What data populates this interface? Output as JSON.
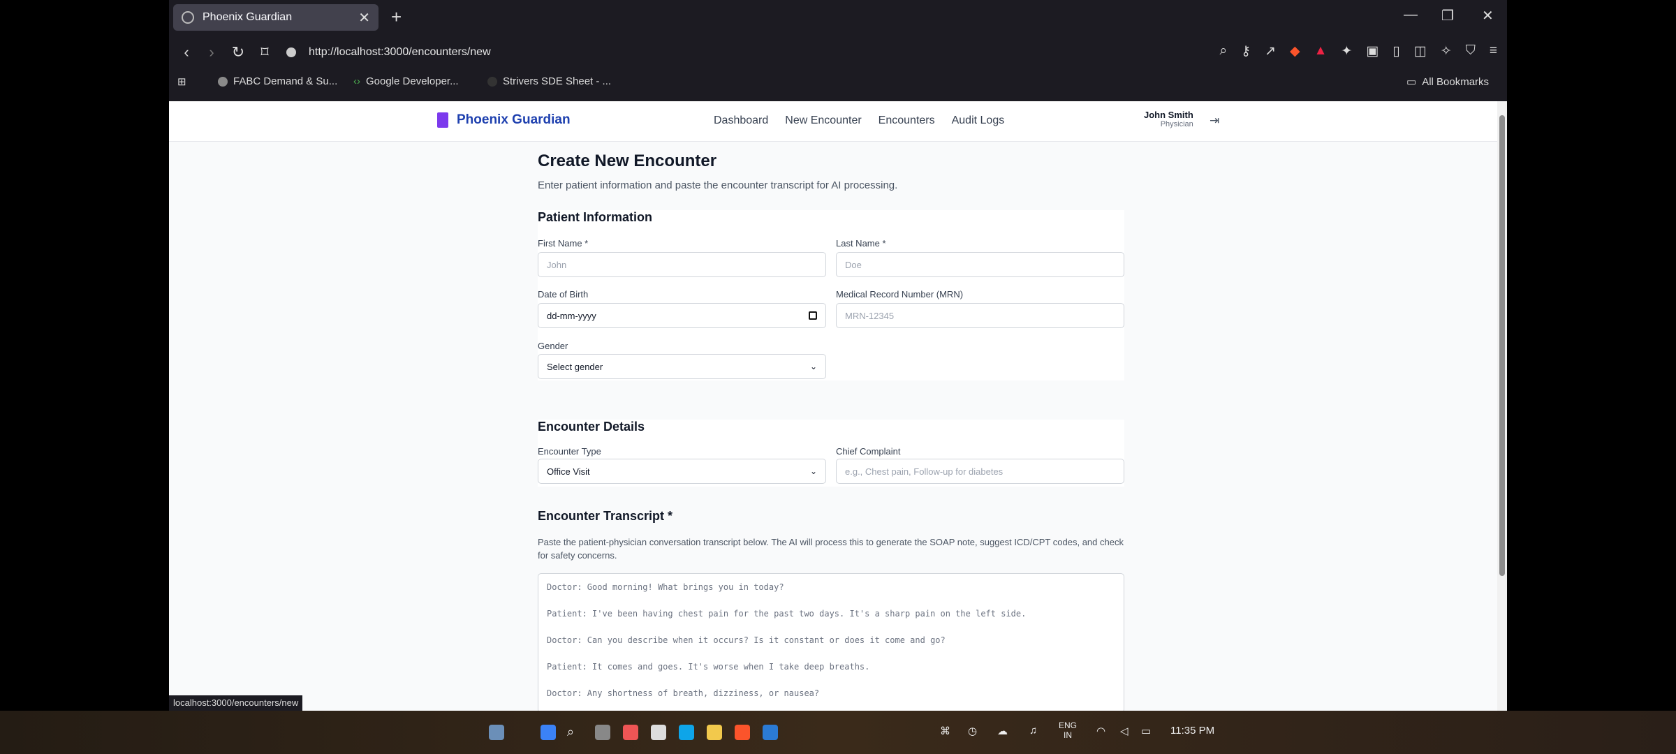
{
  "browser": {
    "tab_title": "Phoenix Guardian",
    "url": "http://localhost:3000/encounters/new",
    "bookmarks": [
      "FABC Demand & Su...",
      "Google Developer...",
      "Strivers SDE Sheet - ..."
    ],
    "all_bookmarks": "All Bookmarks",
    "status_url": "localhost:3000/encounters/new"
  },
  "app": {
    "brand": "Phoenix Guardian",
    "nav": [
      "Dashboard",
      "New Encounter",
      "Encounters",
      "Audit Logs"
    ],
    "user_name": "John Smith",
    "user_role": "Physician"
  },
  "page": {
    "title": "Create New Encounter",
    "subtitle": "Enter patient information and paste the encounter transcript for AI processing."
  },
  "patient": {
    "title": "Patient Information",
    "first_name_label": "First Name *",
    "first_name_placeholder": "John",
    "last_name_label": "Last Name *",
    "last_name_placeholder": "Doe",
    "dob_label": "Date of Birth",
    "dob_placeholder": "dd-mm-yyyy",
    "mrn_label": "Medical Record Number (MRN)",
    "mrn_placeholder": "MRN-12345",
    "gender_label": "Gender",
    "gender_value": "Select gender"
  },
  "encounter": {
    "title": "Encounter Details",
    "type_label": "Encounter Type",
    "type_value": "Office Visit",
    "complaint_label": "Chief Complaint",
    "complaint_placeholder": "e.g., Chest pain, Follow-up for diabetes"
  },
  "transcript": {
    "title": "Encounter Transcript *",
    "help": "Paste the patient-physician conversation transcript below. The AI will process this to generate the SOAP note, suggest ICD/CPT codes, and check for safety concerns.",
    "lines": [
      "Doctor: Good morning! What brings you in today?",
      "Patient: I've been having chest pain for the past two days. It's a sharp pain on the left side.",
      "Doctor: Can you describe when it occurs? Is it constant or does it come and go?",
      "Patient: It comes and goes. It's worse when I take deep breaths.",
      "Doctor: Any shortness of breath, dizziness, or nausea?"
    ]
  },
  "taskbar": {
    "lang": "ENG",
    "region": "IN",
    "time": "11:35 PM"
  }
}
